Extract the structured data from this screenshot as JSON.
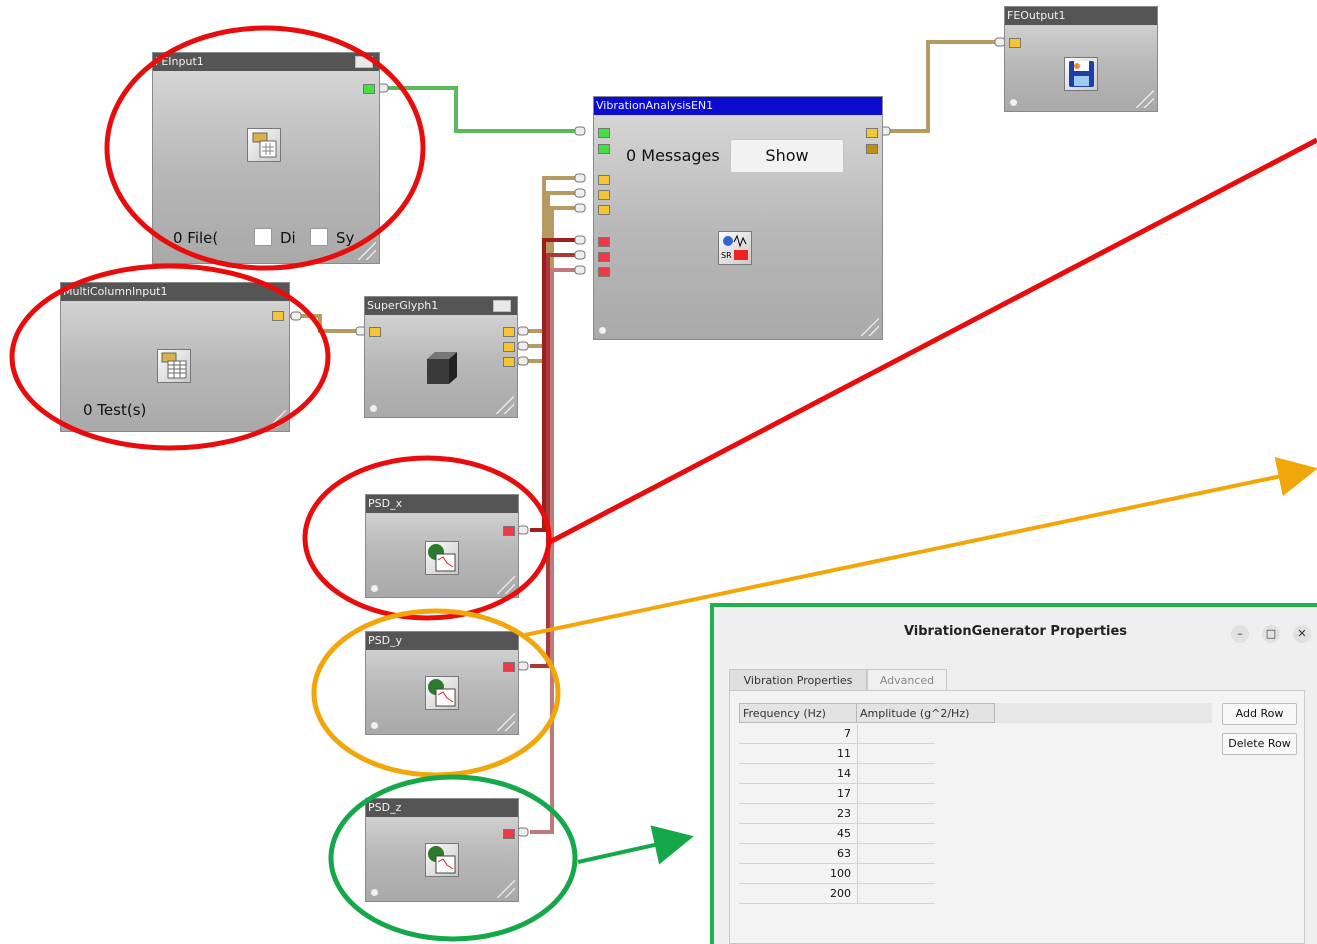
{
  "glyphs": {
    "feinput": {
      "title": "FEInput1",
      "file_count": "0 File(",
      "check1_label": "Di",
      "check2_label": "Sy"
    },
    "multicolumn": {
      "title": "MultiColumnInput1",
      "tests": "0 Test(s)"
    },
    "superglyph": {
      "title": "SuperGlyph1"
    },
    "vibration_analysis": {
      "title": "VibrationAnalysisEN1",
      "messages": "0 Messages",
      "show_button": "Show"
    },
    "feoutput": {
      "title": "FEOutput1"
    },
    "psd_x": {
      "title": "PSD_x"
    },
    "psd_y": {
      "title": "PSD_y"
    },
    "psd_z": {
      "title": "PSD_z"
    }
  },
  "colors": {
    "highlight_red": "#e80c0c",
    "highlight_orange": "#f2a60a",
    "highlight_green": "#14a84a",
    "title_bar": "#555555",
    "title_bar_active": "#0b0bd2",
    "port_yellow": "#f7c531",
    "port_green": "#41e13f",
    "port_red": "#f03a43"
  },
  "dialog": {
    "title": "VibrationGenerator Properties",
    "tabs": [
      "Vibration Properties",
      "Advanced"
    ],
    "active_tab": "Vibration Properties",
    "columns": [
      "Frequency (Hz)",
      "Amplitude (g^2/Hz)"
    ],
    "frequencies": [
      "7",
      "11",
      "14",
      "17",
      "23",
      "45",
      "63",
      "100",
      "200"
    ],
    "add_row_label": "Add Row",
    "delete_row_label": "Delete Row",
    "window_buttons": [
      "minimize-icon",
      "maximize-icon",
      "close-icon"
    ]
  }
}
